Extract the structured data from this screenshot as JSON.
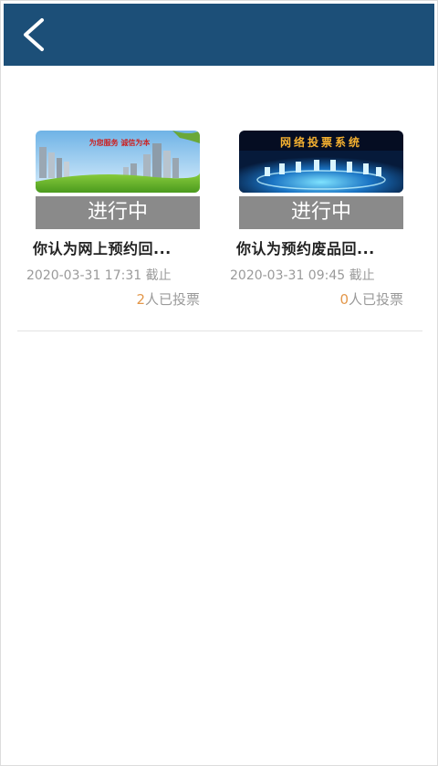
{
  "topbar": {
    "color": "#1c4f78",
    "back_icon": "chevron-left-icon"
  },
  "polls": [
    {
      "banner_text": "为您服务   诚信为本",
      "status": "进行中",
      "title": "你认为网上预约回...",
      "deadline": "2020-03-31 17:31 截止",
      "vote_count": "2",
      "vote_suffix": "人已投票"
    },
    {
      "banner_text": "网络投票系统",
      "status": "进行中",
      "title": "你认为预约废品回...",
      "deadline": "2020-03-31 09:45 截止",
      "vote_count": "0",
      "vote_suffix": "人已投票"
    }
  ],
  "colors": {
    "status_bg": "#8a8a8a",
    "vote_count": "#e3974a",
    "muted_text": "#9a9a9a"
  }
}
